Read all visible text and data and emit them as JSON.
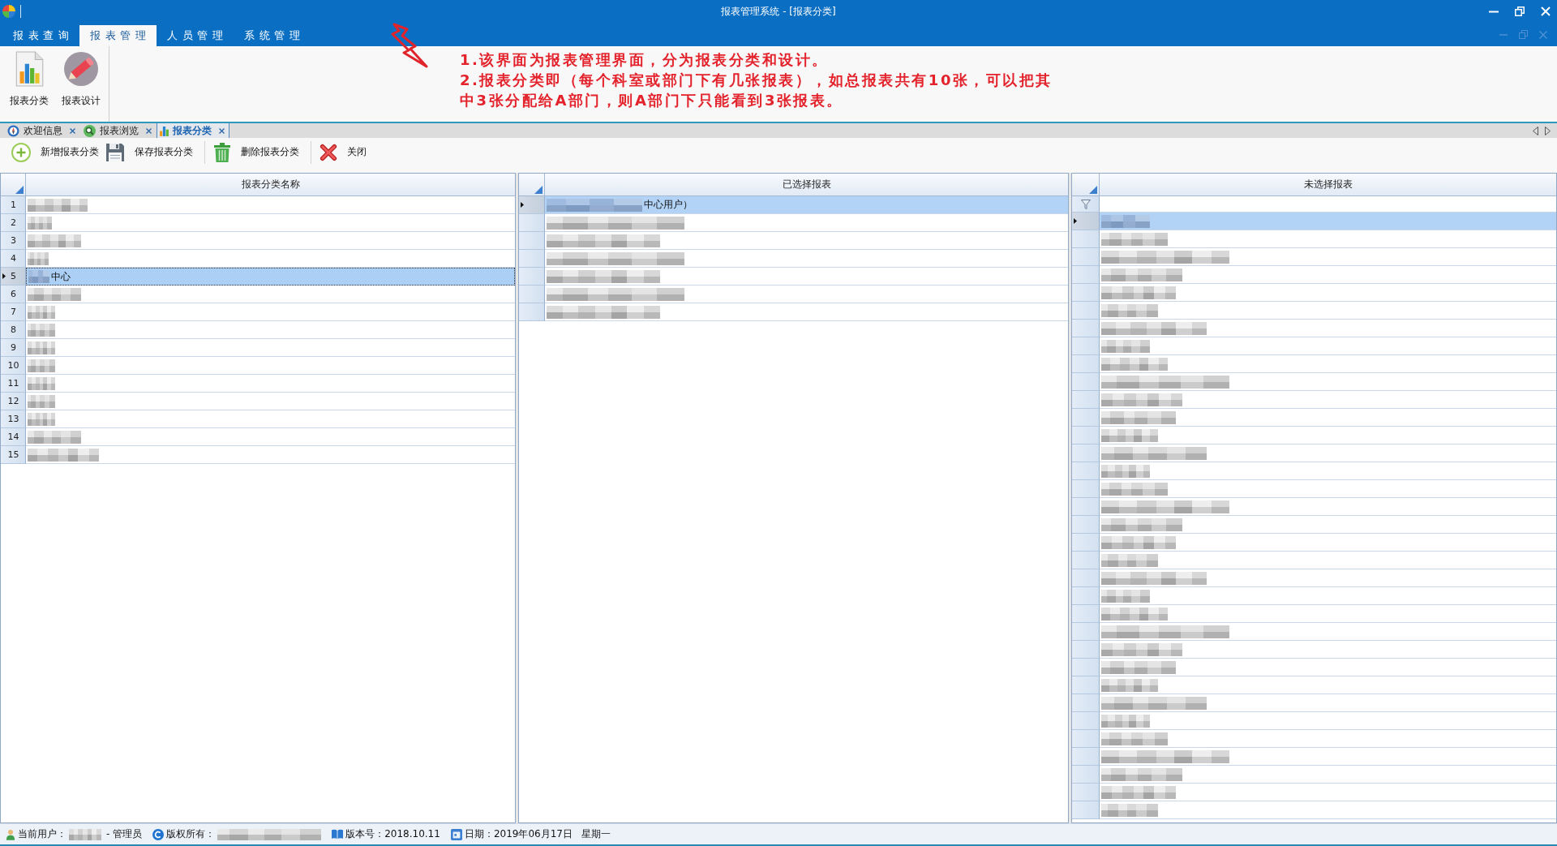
{
  "window": {
    "title": "报表管理系统 - [报表分类]"
  },
  "ribbon_tabs": [
    {
      "label": "报表查询",
      "selected": false
    },
    {
      "label": "报表管理",
      "selected": true
    },
    {
      "label": "人员管理",
      "selected": false
    },
    {
      "label": "系统管理",
      "selected": false
    }
  ],
  "ribbon_buttons": [
    {
      "label": "报表分类",
      "kind": "chart"
    },
    {
      "label": "报表设计",
      "kind": "pencil"
    }
  ],
  "annotation": {
    "notes": [
      "1.该界面为报表管理界面，分为报表分类和设计。",
      "2.报表分类即（每个科室或部门下有几张报表），如总报表共有10张，可以把其中3张分配给A部门，则A部门下只能看到3张报表。"
    ]
  },
  "document_tabs": [
    {
      "label": "欢迎信息",
      "kind": "welcome",
      "selected": false
    },
    {
      "label": "报表浏览",
      "kind": "browse",
      "selected": false
    },
    {
      "label": "报表分类",
      "kind": "chart",
      "selected": true
    }
  ],
  "toolbar": [
    {
      "label": "新增报表分类",
      "kind": "add"
    },
    {
      "label": "保存报表分类",
      "kind": "save"
    },
    {
      "label": "删除报表分类",
      "kind": "delete"
    },
    {
      "label": "关闭",
      "kind": "close"
    }
  ],
  "category_grid": {
    "column": "报表分类名称",
    "rows": [
      {
        "number": "1",
        "redacted": true,
        "selected": false
      },
      {
        "number": "2",
        "redacted": true,
        "selected": false
      },
      {
        "number": "3",
        "redacted": true,
        "selected": false
      },
      {
        "number": "4",
        "redacted": true,
        "selected": false
      },
      {
        "number": "5",
        "redacted": true,
        "name": "中心",
        "selected": true
      },
      {
        "number": "6",
        "redacted": true,
        "selected": false
      },
      {
        "number": "7",
        "redacted": true,
        "selected": false
      },
      {
        "number": "8",
        "redacted": true,
        "selected": false
      },
      {
        "number": "9",
        "redacted": true,
        "selected": false
      },
      {
        "number": "10",
        "redacted": true,
        "selected": false
      },
      {
        "number": "11",
        "redacted": true,
        "selected": false
      },
      {
        "number": "12",
        "redacted": true,
        "selected": false
      },
      {
        "number": "13",
        "redacted": true,
        "selected": false
      },
      {
        "number": "14",
        "redacted": true,
        "selected": false
      },
      {
        "number": "15",
        "redacted": true,
        "selected": false
      }
    ]
  },
  "selected_reports": {
    "column": "已选择报表",
    "rows": [
      {
        "redacted": true,
        "name": "中心用户）",
        "selected": true
      },
      {
        "redacted": true,
        "selected": false
      },
      {
        "redacted": true,
        "selected": false
      },
      {
        "redacted": true,
        "selected": false
      },
      {
        "redacted": true,
        "selected": false
      },
      {
        "redacted": true,
        "selected": false
      },
      {
        "redacted": true,
        "selected": false
      }
    ]
  },
  "unselected_reports": {
    "column": "未选择报表",
    "filter_row": true,
    "rows": [
      {
        "redacted": true,
        "selected": true
      },
      {
        "redacted": true,
        "selected": false
      },
      {
        "redacted": true,
        "selected": false
      },
      {
        "redacted": true,
        "selected": false
      },
      {
        "redacted": true,
        "selected": false
      },
      {
        "redacted": true,
        "selected": false
      },
      {
        "redacted": true,
        "selected": false
      },
      {
        "redacted": true,
        "selected": false
      },
      {
        "redacted": true,
        "selected": false
      },
      {
        "redacted": true,
        "selected": false
      },
      {
        "redacted": true,
        "selected": false
      },
      {
        "redacted": true,
        "selected": false
      },
      {
        "redacted": true,
        "selected": false
      },
      {
        "redacted": true,
        "selected": false
      },
      {
        "redacted": true,
        "selected": false
      },
      {
        "redacted": true,
        "selected": false
      },
      {
        "redacted": true,
        "selected": false
      },
      {
        "redacted": true,
        "selected": false
      },
      {
        "redacted": true,
        "selected": false
      },
      {
        "redacted": true,
        "selected": false
      },
      {
        "redacted": true,
        "selected": false
      },
      {
        "redacted": true,
        "selected": false
      },
      {
        "redacted": true,
        "selected": false
      },
      {
        "redacted": true,
        "selected": false
      },
      {
        "redacted": true,
        "selected": false
      },
      {
        "redacted": true,
        "selected": false
      },
      {
        "redacted": true,
        "selected": false
      },
      {
        "redacted": true,
        "selected": false
      },
      {
        "redacted": true,
        "selected": false
      },
      {
        "redacted": true,
        "selected": false
      },
      {
        "redacted": true,
        "selected": false
      },
      {
        "redacted": true,
        "selected": false
      },
      {
        "redacted": true,
        "selected": false
      },
      {
        "redacted": true,
        "selected": false
      }
    ]
  },
  "status_bar": {
    "user": {
      "label": "当前用户：",
      "redacted": true,
      "role": "- 管理员"
    },
    "copyright": {
      "label": "版权所有：",
      "redacted": true
    },
    "version": "版本号：2018.10.11",
    "date": "日期：2019年06月17日",
    "weekday": "星期一"
  }
}
